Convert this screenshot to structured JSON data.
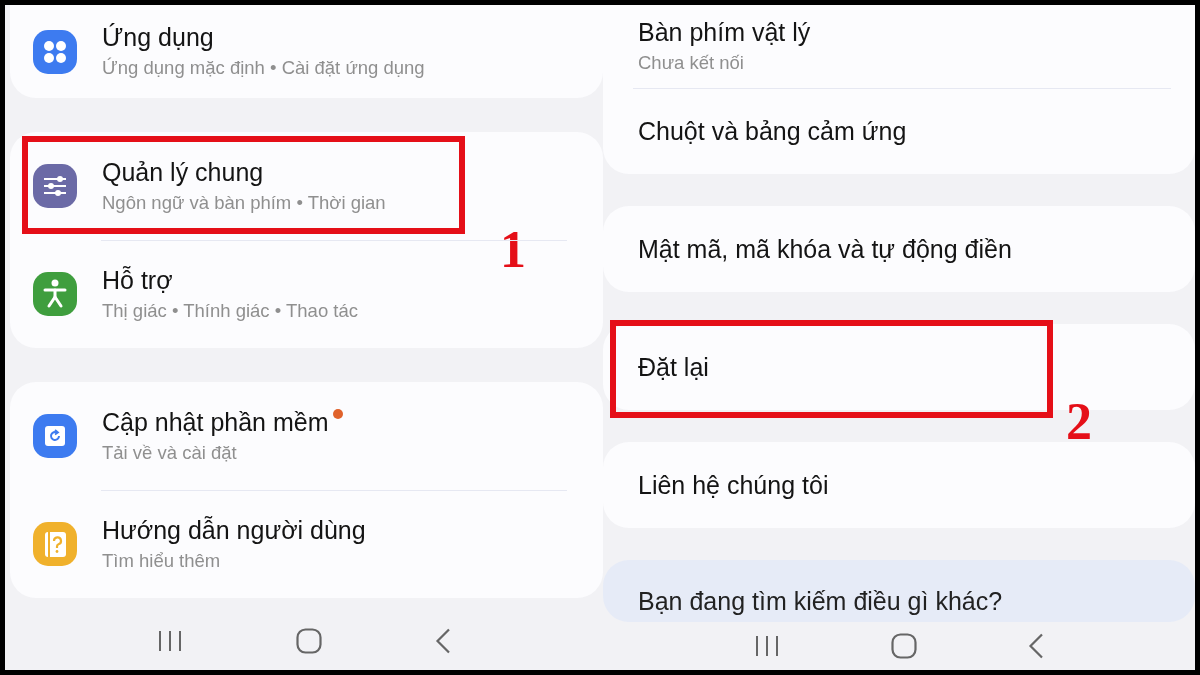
{
  "panels": [
    {
      "groups": [
        {
          "kind": "list",
          "items": [
            {
              "title": "Ứng dụng",
              "subtitle": "Ứng dụng mặc định  •  Cài đặt ứng dụng",
              "highlighted": false,
              "notification": false
            }
          ]
        },
        {
          "kind": "list",
          "items": [
            {
              "title": "Quản lý chung",
              "subtitle": "Ngôn ngữ và bàn phím  •  Thời gian",
              "highlighted": true,
              "callout": "1",
              "notification": false
            },
            {
              "title": "Hỗ trợ",
              "subtitle": "Thị giác  •  Thính giác  •  Thao tác",
              "highlighted": false,
              "notification": false
            }
          ]
        },
        {
          "kind": "list",
          "items": [
            {
              "title": "Cập nhật phần mềm",
              "subtitle": "Tải về và cài đặt",
              "highlighted": false,
              "notification": true
            },
            {
              "title": "Hướng dẫn người dùng",
              "subtitle": "Tìm hiểu thêm",
              "highlighted": false,
              "notification": false
            }
          ]
        }
      ]
    },
    {
      "groups": [
        {
          "kind": "list",
          "items": [
            {
              "title": "Bàn phím vật lý",
              "subtitle": "Chưa kết nối",
              "highlighted": false,
              "notification": false
            },
            {
              "title": "Chuột và bảng cảm ứng",
              "highlighted": false,
              "notification": false
            }
          ]
        },
        {
          "kind": "list",
          "items": [
            {
              "title": "Mật mã, mã khóa và tự động điền",
              "highlighted": false,
              "notification": false
            }
          ]
        },
        {
          "kind": "list",
          "items": [
            {
              "title": "Đặt lại",
              "highlighted": true,
              "callout": "2",
              "notification": false
            }
          ]
        },
        {
          "kind": "list",
          "items": [
            {
              "title": "Liên hệ chúng tôi",
              "highlighted": false,
              "notification": false
            }
          ]
        },
        {
          "kind": "suggestion",
          "items": [
            {
              "title": "Bạn đang tìm kiếm điều gì khác?"
            }
          ]
        }
      ]
    }
  ]
}
